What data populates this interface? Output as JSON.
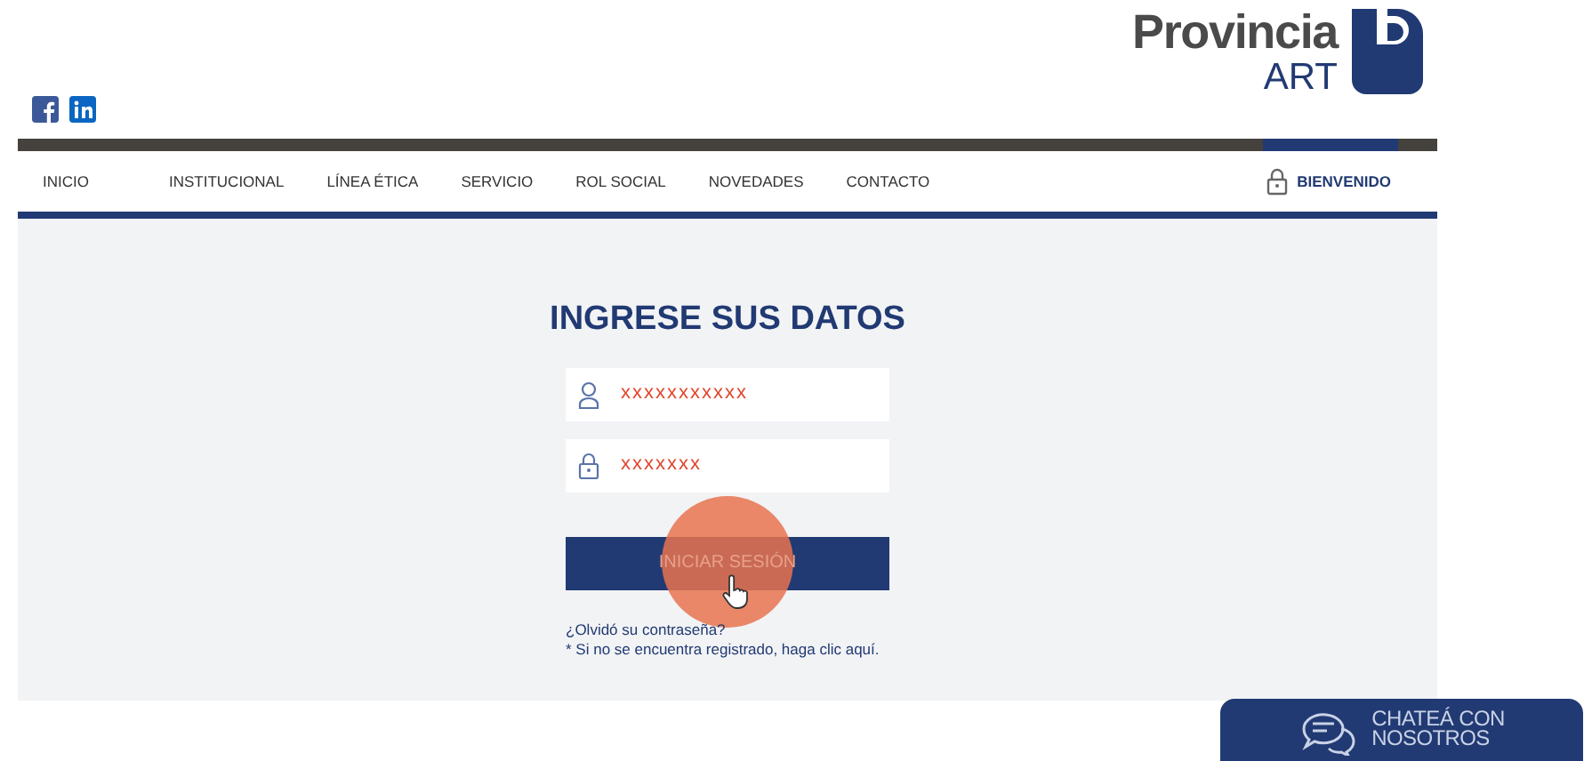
{
  "logo": {
    "name": "Provincia",
    "sub": "ART"
  },
  "nav": [
    {
      "label": "INICIO",
      "selected": false
    },
    {
      "label": "INSTITUCIONAL",
      "selected": false
    },
    {
      "label": "LÍNEA ÉTICA",
      "selected": false
    },
    {
      "label": "SERVICIO",
      "selected": false
    },
    {
      "label": "ROL SOCIAL",
      "selected": false
    },
    {
      "label": "NOVEDADES",
      "selected": false
    },
    {
      "label": "CONTACTO",
      "selected": false
    }
  ],
  "account": {
    "label": "BIENVENIDO",
    "selected": true
  },
  "login": {
    "title": "INGRESE SUS DATOS",
    "fields": [
      {
        "kind": "user",
        "value": "xxxxxxxxxxx"
      },
      {
        "kind": "password",
        "value": "xxxxxxx"
      }
    ],
    "button": "INICIAR SESIÓN",
    "links": [
      "¿Olvidó su contraseña?",
      "* Si no se encuentra registrado, haga clic aquí."
    ]
  },
  "chat": {
    "lines": [
      "CHATEÁ CON",
      "NOSOTROS"
    ]
  }
}
